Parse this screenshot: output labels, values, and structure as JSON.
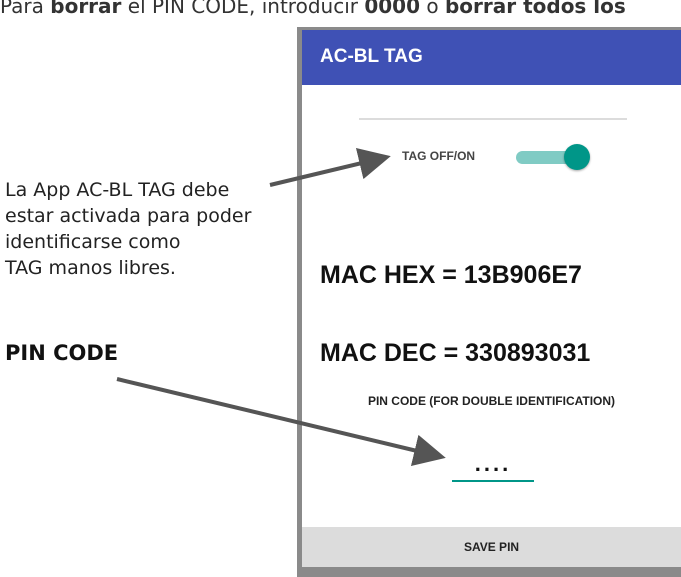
{
  "instruction": {
    "prefix": "Para ",
    "bold1": "borrar",
    "mid": " el PIN CODE, introducir ",
    "bold2": "0000",
    "mid2": " o ",
    "bold3": "borrar todos los"
  },
  "app": {
    "title": "AC-BL TAG",
    "toggle_label": "TAG OFF/ON",
    "toggle_state": "on",
    "mac_hex": "MAC HEX = 13B906E7",
    "mac_dec": "MAC DEC = 330893031",
    "pin_label": "PIN CODE (FOR DOUBLE IDENTIFICATION)",
    "pin_value": "....",
    "save_button": "SAVE PIN",
    "colors": {
      "appbar": "#3f51b5",
      "accent": "#009688"
    }
  },
  "annotations": {
    "toggle_note": [
      "La App AC-BL TAG debe",
      "estar activada para poder",
      "identificarse como",
      "TAG manos libres."
    ],
    "pin_title": "PIN CODE"
  }
}
